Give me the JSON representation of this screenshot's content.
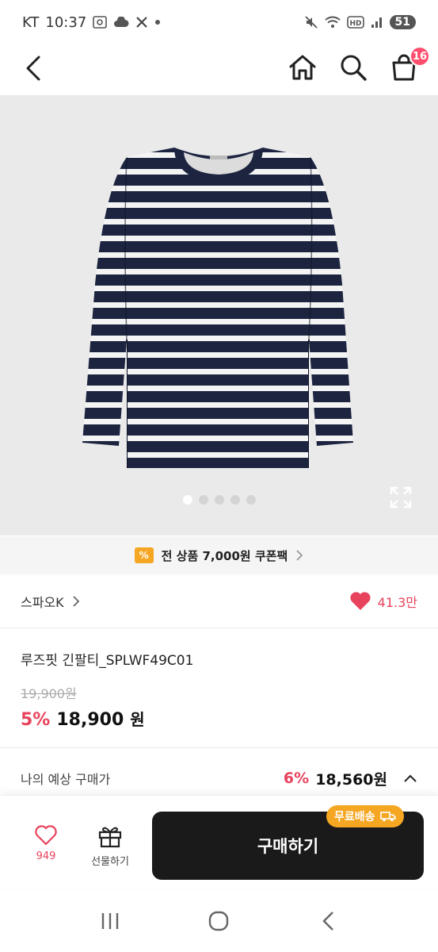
{
  "status_bar": {
    "carrier": "KT",
    "time": "10:37",
    "battery": "51",
    "network_badge": "HD"
  },
  "header": {
    "cart_count": "16"
  },
  "gallery": {
    "total_images": 5,
    "active_index": 0
  },
  "coupon": {
    "icon_text": "%",
    "text": "전 상품 7,000원 쿠폰팩"
  },
  "brand": {
    "name": "스파오K",
    "like_count": "41.3만"
  },
  "product": {
    "title": "루즈핏 긴팔티_SPLWF49C01",
    "original_price": "19,900원",
    "discount_rate": "5%",
    "price": "18,900",
    "price_unit": "원"
  },
  "expected": {
    "label": "나의 예상 구매가",
    "rate": "6%",
    "price": "18,560원"
  },
  "actions": {
    "wish_count": "949",
    "gift_label": "선물하기",
    "buy_label": "구매하기",
    "free_shipping_label": "무료배송"
  },
  "colors": {
    "accent_pink": "#e8435d",
    "badge_pink": "#ff4f6e",
    "coupon_orange": "#f5a623",
    "buy_button": "#1a1a1a",
    "shirt_navy": "#1c2440"
  }
}
